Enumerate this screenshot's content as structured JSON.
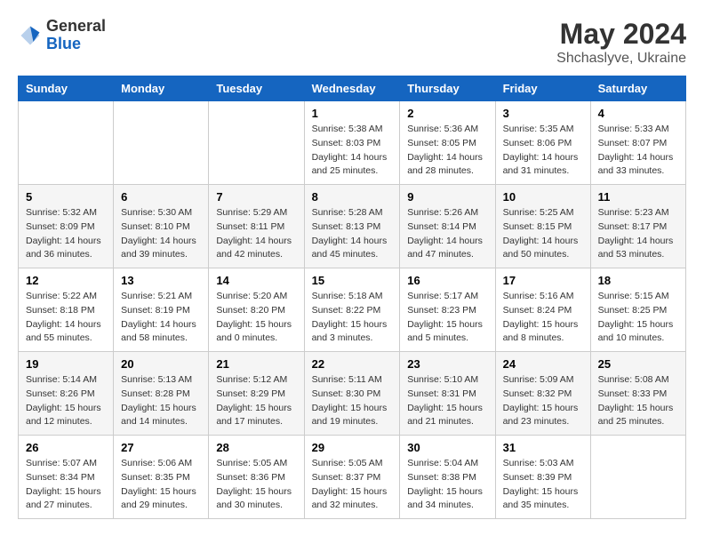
{
  "header": {
    "logo_general": "General",
    "logo_blue": "Blue",
    "month_year": "May 2024",
    "location": "Shchaslyve, Ukraine"
  },
  "weekdays": [
    "Sunday",
    "Monday",
    "Tuesday",
    "Wednesday",
    "Thursday",
    "Friday",
    "Saturday"
  ],
  "weeks": [
    [
      {
        "day": "",
        "info": ""
      },
      {
        "day": "",
        "info": ""
      },
      {
        "day": "",
        "info": ""
      },
      {
        "day": "1",
        "info": "Sunrise: 5:38 AM\nSunset: 8:03 PM\nDaylight: 14 hours\nand 25 minutes."
      },
      {
        "day": "2",
        "info": "Sunrise: 5:36 AM\nSunset: 8:05 PM\nDaylight: 14 hours\nand 28 minutes."
      },
      {
        "day": "3",
        "info": "Sunrise: 5:35 AM\nSunset: 8:06 PM\nDaylight: 14 hours\nand 31 minutes."
      },
      {
        "day": "4",
        "info": "Sunrise: 5:33 AM\nSunset: 8:07 PM\nDaylight: 14 hours\nand 33 minutes."
      }
    ],
    [
      {
        "day": "5",
        "info": "Sunrise: 5:32 AM\nSunset: 8:09 PM\nDaylight: 14 hours\nand 36 minutes."
      },
      {
        "day": "6",
        "info": "Sunrise: 5:30 AM\nSunset: 8:10 PM\nDaylight: 14 hours\nand 39 minutes."
      },
      {
        "day": "7",
        "info": "Sunrise: 5:29 AM\nSunset: 8:11 PM\nDaylight: 14 hours\nand 42 minutes."
      },
      {
        "day": "8",
        "info": "Sunrise: 5:28 AM\nSunset: 8:13 PM\nDaylight: 14 hours\nand 45 minutes."
      },
      {
        "day": "9",
        "info": "Sunrise: 5:26 AM\nSunset: 8:14 PM\nDaylight: 14 hours\nand 47 minutes."
      },
      {
        "day": "10",
        "info": "Sunrise: 5:25 AM\nSunset: 8:15 PM\nDaylight: 14 hours\nand 50 minutes."
      },
      {
        "day": "11",
        "info": "Sunrise: 5:23 AM\nSunset: 8:17 PM\nDaylight: 14 hours\nand 53 minutes."
      }
    ],
    [
      {
        "day": "12",
        "info": "Sunrise: 5:22 AM\nSunset: 8:18 PM\nDaylight: 14 hours\nand 55 minutes."
      },
      {
        "day": "13",
        "info": "Sunrise: 5:21 AM\nSunset: 8:19 PM\nDaylight: 14 hours\nand 58 minutes."
      },
      {
        "day": "14",
        "info": "Sunrise: 5:20 AM\nSunset: 8:20 PM\nDaylight: 15 hours\nand 0 minutes."
      },
      {
        "day": "15",
        "info": "Sunrise: 5:18 AM\nSunset: 8:22 PM\nDaylight: 15 hours\nand 3 minutes."
      },
      {
        "day": "16",
        "info": "Sunrise: 5:17 AM\nSunset: 8:23 PM\nDaylight: 15 hours\nand 5 minutes."
      },
      {
        "day": "17",
        "info": "Sunrise: 5:16 AM\nSunset: 8:24 PM\nDaylight: 15 hours\nand 8 minutes."
      },
      {
        "day": "18",
        "info": "Sunrise: 5:15 AM\nSunset: 8:25 PM\nDaylight: 15 hours\nand 10 minutes."
      }
    ],
    [
      {
        "day": "19",
        "info": "Sunrise: 5:14 AM\nSunset: 8:26 PM\nDaylight: 15 hours\nand 12 minutes."
      },
      {
        "day": "20",
        "info": "Sunrise: 5:13 AM\nSunset: 8:28 PM\nDaylight: 15 hours\nand 14 minutes."
      },
      {
        "day": "21",
        "info": "Sunrise: 5:12 AM\nSunset: 8:29 PM\nDaylight: 15 hours\nand 17 minutes."
      },
      {
        "day": "22",
        "info": "Sunrise: 5:11 AM\nSunset: 8:30 PM\nDaylight: 15 hours\nand 19 minutes."
      },
      {
        "day": "23",
        "info": "Sunrise: 5:10 AM\nSunset: 8:31 PM\nDaylight: 15 hours\nand 21 minutes."
      },
      {
        "day": "24",
        "info": "Sunrise: 5:09 AM\nSunset: 8:32 PM\nDaylight: 15 hours\nand 23 minutes."
      },
      {
        "day": "25",
        "info": "Sunrise: 5:08 AM\nSunset: 8:33 PM\nDaylight: 15 hours\nand 25 minutes."
      }
    ],
    [
      {
        "day": "26",
        "info": "Sunrise: 5:07 AM\nSunset: 8:34 PM\nDaylight: 15 hours\nand 27 minutes."
      },
      {
        "day": "27",
        "info": "Sunrise: 5:06 AM\nSunset: 8:35 PM\nDaylight: 15 hours\nand 29 minutes."
      },
      {
        "day": "28",
        "info": "Sunrise: 5:05 AM\nSunset: 8:36 PM\nDaylight: 15 hours\nand 30 minutes."
      },
      {
        "day": "29",
        "info": "Sunrise: 5:05 AM\nSunset: 8:37 PM\nDaylight: 15 hours\nand 32 minutes."
      },
      {
        "day": "30",
        "info": "Sunrise: 5:04 AM\nSunset: 8:38 PM\nDaylight: 15 hours\nand 34 minutes."
      },
      {
        "day": "31",
        "info": "Sunrise: 5:03 AM\nSunset: 8:39 PM\nDaylight: 15 hours\nand 35 minutes."
      },
      {
        "day": "",
        "info": ""
      }
    ]
  ]
}
